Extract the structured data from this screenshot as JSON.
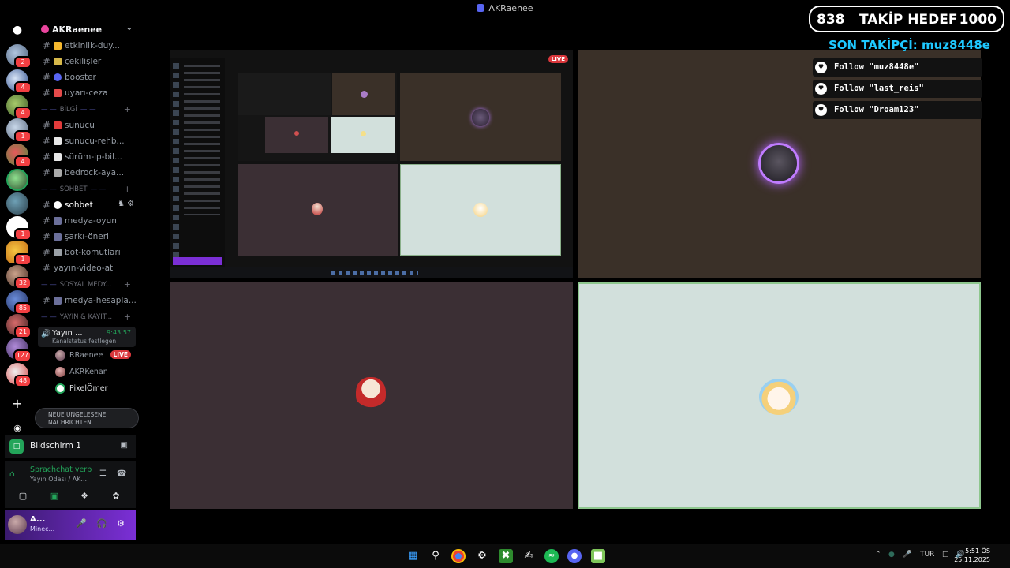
{
  "window": {
    "title": "AKRaenee"
  },
  "rail": {
    "badges": [
      "2",
      "4",
      "4",
      "1",
      "4",
      "1",
      "1",
      "32",
      "85",
      "21",
      "127",
      "48"
    ]
  },
  "server": {
    "name": "AKRaenee"
  },
  "channels_top": [
    {
      "name": "etkinlik-duy...",
      "icon_color": "#f5b82e"
    },
    {
      "name": "çekilişler",
      "icon_color": "#d6b84a"
    },
    {
      "name": "booster",
      "icon_color": "#5865f2"
    },
    {
      "name": "uyarı-ceza",
      "icon_color": "#e54a4a"
    }
  ],
  "category_bilgi": "BİLGİ",
  "channels_bilgi": [
    {
      "name": "sunucu",
      "icon_color": "#e23b3b"
    },
    {
      "name": "sunucu-rehb...",
      "icon_color": "#e8e8e8"
    },
    {
      "name": "sürüm-ip-bil...",
      "icon_color": "#e8e8e8"
    },
    {
      "name": "bedrock-aya...",
      "icon_color": "#aaaaaa"
    }
  ],
  "category_sohbet": "SOHBET",
  "channels_sohbet": [
    {
      "name": "sohbet",
      "icon_color": "#ffffff"
    },
    {
      "name": "medya-oyun",
      "icon_color": "#6b6f9a"
    },
    {
      "name": "şarkı-öneri",
      "icon_color": "#6b6f9a"
    },
    {
      "name": "bot-komutları",
      "icon_color": "#9aa0a6"
    },
    {
      "name": "yayın-video-at",
      "icon_color": ""
    }
  ],
  "category_sosyal": "SOSYAL MEDY...",
  "channels_sosyal": [
    {
      "name": "medya-hesapla...",
      "icon_color": "#6b6f9a"
    }
  ],
  "category_yayin": "YAYIN & KAYIT...",
  "voice_channel": {
    "name": "Yayın ...",
    "timer": "9:43:57",
    "status": "Kanalstatus festlegen"
  },
  "voice_users": [
    {
      "name": "RRaenee",
      "live": "LIVE"
    },
    {
      "name": "AKRKenan",
      "live": ""
    },
    {
      "name": "PixelÖmer",
      "live": ""
    }
  ],
  "unread_pill": {
    "line1": "NEUE UNGELESENE",
    "line2": "NACHRICHTEN"
  },
  "screen_panel": {
    "label": "Bildschirm 1"
  },
  "voice_panel": {
    "title": "Sprachchat verb",
    "subtitle": "Yayın Odası / AK..."
  },
  "user_panel": {
    "name": "A...",
    "status": "Minec..."
  },
  "stage": {
    "live_label": "LIVE",
    "tile_bg_dark": "#3b2f34",
    "tile_bg_light": "#d2e0dc",
    "tile_bg_brown": "#3a3028"
  },
  "overlay": {
    "current_followers": "838",
    "goal_label": "TAKİP HEDEF",
    "goal": "1000",
    "last_follower": "SON TAKİPÇİ: muz8448e",
    "alerts": [
      "Follow \"muz8448e\"",
      "Follow \"last_reis\"",
      "Follow \"Droam123\""
    ]
  },
  "taskbar": {
    "lang": "TUR",
    "time": "5:51 ÖS",
    "date": "25.11.2025"
  }
}
